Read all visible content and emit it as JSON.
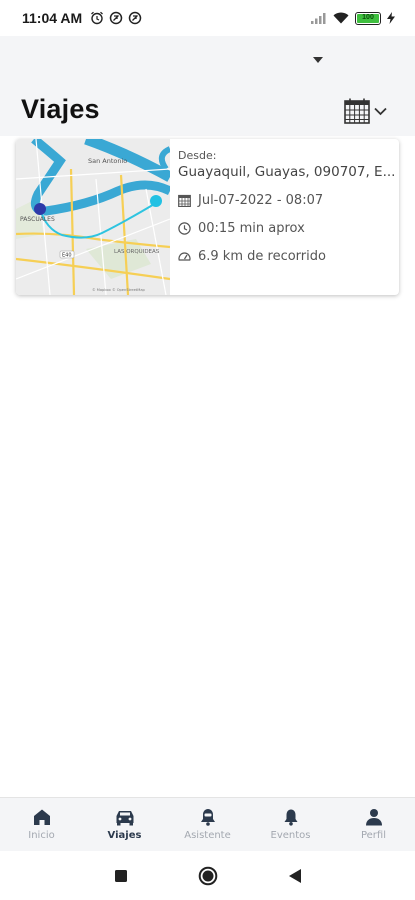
{
  "status_bar": {
    "time": "11:04 AM",
    "left_icons": [
      "alarm-icon",
      "app-notification-icon",
      "app-notification-icon"
    ],
    "right_icons": [
      "signal-icon",
      "wifi-icon",
      "battery-icon",
      "charging-icon"
    ],
    "battery_level": "100"
  },
  "header": {
    "title": "Viajes",
    "dropdown_icon": "caret-down-icon",
    "calendar_icon": "calendar-icon"
  },
  "trip": {
    "from_label": "Desde:",
    "from_value": "Guayaquil, Guayas, 090707, E...",
    "date": "Jul-07-2022 - 08:07",
    "duration": "00:15 min aprox",
    "distance": "6.9 km de recorrido",
    "map_labels": {
      "place_1": "San Antonio",
      "place_2": "PASCUALES",
      "place_3": "LAS ORQUIDEAS",
      "road": "E40",
      "attribution": "© Mapbox © OpenStreetMap"
    },
    "colors": {
      "route": "#2ec4e0",
      "start": "#2e3aa8",
      "end": "#22c1e3"
    }
  },
  "bottom_nav": {
    "items": [
      {
        "label": "Inicio",
        "icon": "home-icon",
        "active": false
      },
      {
        "label": "Viajes",
        "icon": "car-icon",
        "active": true
      },
      {
        "label": "Asistente",
        "icon": "assistant-icon",
        "active": false
      },
      {
        "label": "Eventos",
        "icon": "bell-icon",
        "active": false
      },
      {
        "label": "Perfil",
        "icon": "user-icon",
        "active": false
      }
    ],
    "active_color": "#2c3a4d",
    "inactive_color": "#a3a8b0"
  },
  "system_nav": [
    "recents-icon",
    "home-circle-icon",
    "back-icon"
  ]
}
